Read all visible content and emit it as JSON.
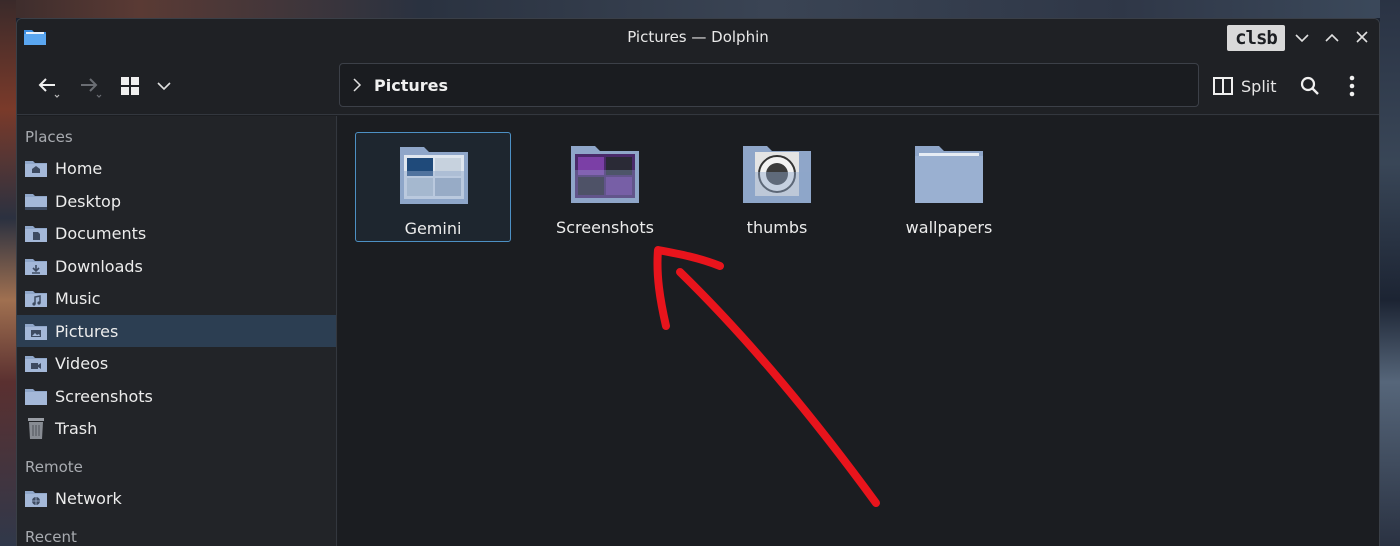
{
  "window": {
    "title": "Pictures — Dolphin",
    "brand": "clsb"
  },
  "toolbar": {
    "back_icon": "arrow-left-icon",
    "forward_icon": "arrow-right-icon",
    "view_mode_icon": "grid-icon",
    "split_label": "Split",
    "search_icon": "search-icon",
    "menu_icon": "kebab-menu-icon"
  },
  "breadcrumb": {
    "current": "Pictures"
  },
  "sidebar": {
    "places_label": "Places",
    "places": [
      {
        "label": "Home",
        "icon": "home-folder-icon"
      },
      {
        "label": "Desktop",
        "icon": "desktop-folder-icon"
      },
      {
        "label": "Documents",
        "icon": "documents-folder-icon"
      },
      {
        "label": "Downloads",
        "icon": "downloads-folder-icon"
      },
      {
        "label": "Music",
        "icon": "music-folder-icon"
      },
      {
        "label": "Pictures",
        "icon": "pictures-folder-icon",
        "active": true
      },
      {
        "label": "Videos",
        "icon": "videos-folder-icon"
      },
      {
        "label": "Screenshots",
        "icon": "folder-icon"
      },
      {
        "label": "Trash",
        "icon": "trash-icon"
      }
    ],
    "remote_label": "Remote",
    "remote": [
      {
        "label": "Network",
        "icon": "network-folder-icon"
      }
    ],
    "recent_label": "Recent"
  },
  "files": [
    {
      "name": "Gemini",
      "selected": true,
      "preview": "light-thumbnails"
    },
    {
      "name": "Screenshots",
      "selected": false,
      "preview": "purple-thumbnails"
    },
    {
      "name": "thumbs",
      "selected": false,
      "preview": "seal-thumbnail"
    },
    {
      "name": "wallpapers",
      "selected": false,
      "preview": "empty"
    }
  ],
  "colors": {
    "accent": "#4d90c4",
    "folder": "#8fa6c9",
    "annotation": "#e8141c"
  }
}
